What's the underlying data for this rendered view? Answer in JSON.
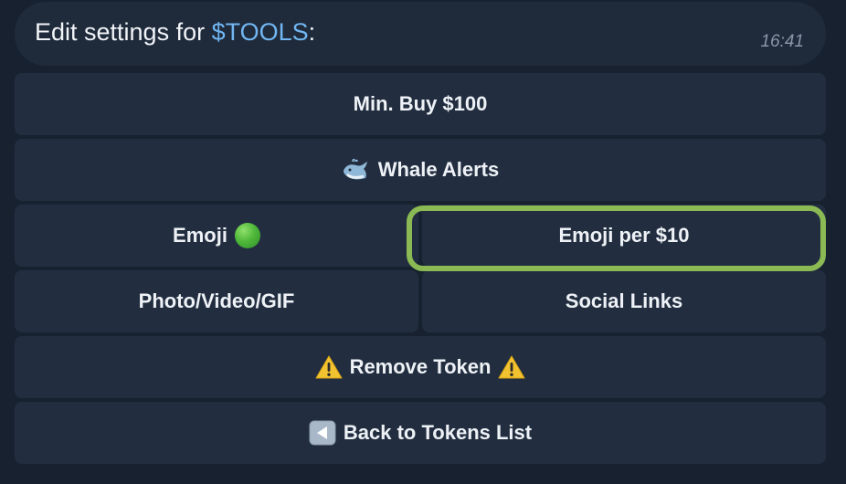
{
  "message": {
    "text_prefix": "Edit settings for ",
    "ticker": "$TOOLS",
    "text_suffix": ":",
    "time": "16:41"
  },
  "keyboard": {
    "min_buy": "Min. Buy $100",
    "whale_alerts": "Whale Alerts",
    "emoji": "Emoji",
    "emoji_per": "Emoji per $10",
    "photo_video_gif": "Photo/Video/GIF",
    "social_links": "Social Links",
    "remove_token": "Remove Token",
    "back_to_tokens": "Back to Tokens List"
  },
  "icons": {
    "whale": "whale-icon",
    "emoji_status": "green-circle-icon",
    "warning": "warning-icon",
    "back": "back-arrow-icon"
  },
  "colors": {
    "ticker": "#71b6f2",
    "highlight": "#8bba55",
    "button_bg": "#222e40",
    "background": "#172130"
  }
}
